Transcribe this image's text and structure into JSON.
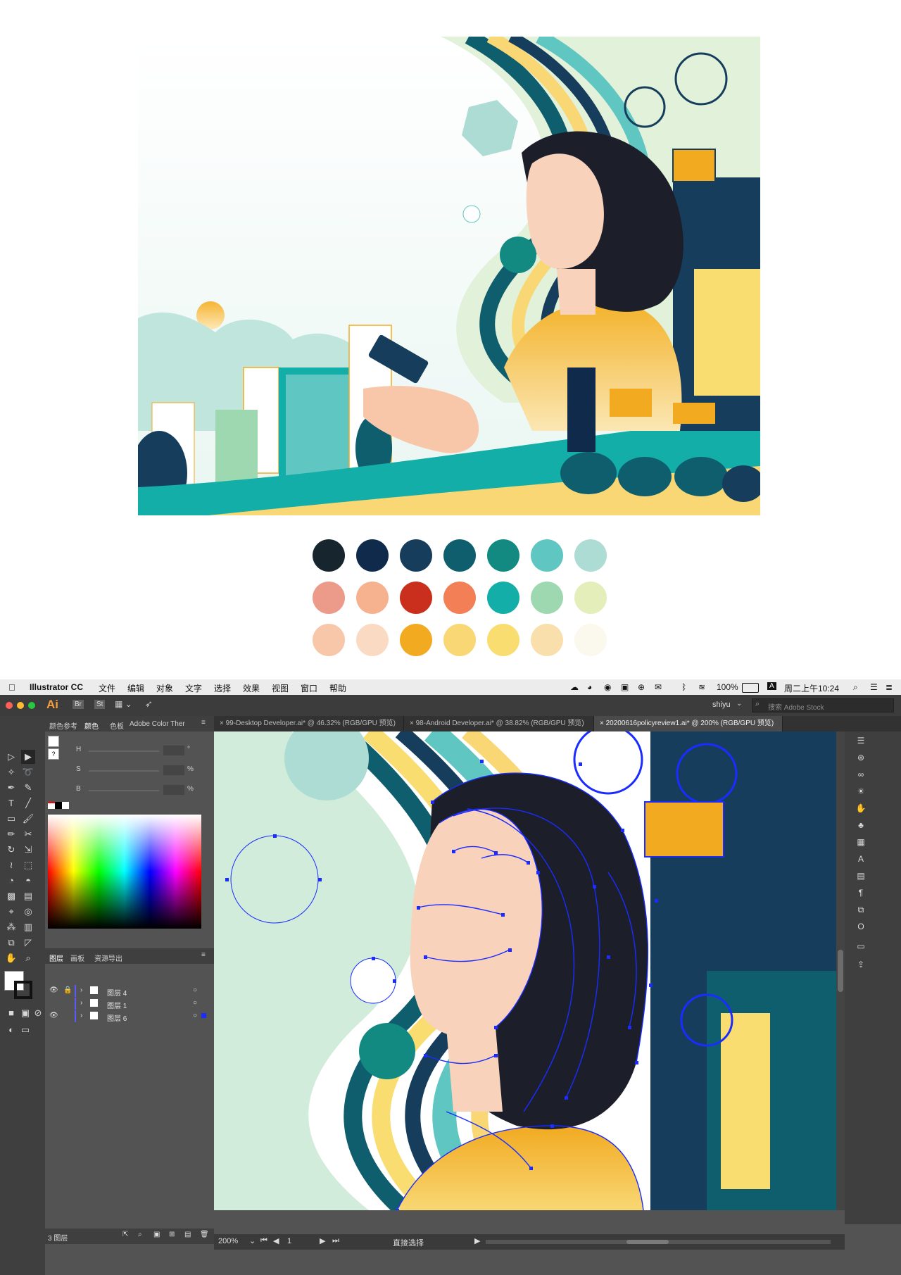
{
  "palette": {
    "row1": [
      "#16252e",
      "#0f2a4a",
      "#163e5c",
      "#0f5e6e",
      "#128a82",
      "#5fc6c2",
      "#acdcd3"
    ],
    "row2": [
      "#ec9a8a",
      "#f6b28e",
      "#c92f1c",
      "#f27f56",
      "#12aea7",
      "#9ed8b0",
      "#e3eebb"
    ],
    "row3": [
      "#f8c6a8",
      "#fbdac3",
      "#f2aa21",
      "#f8d774",
      "#f9dd70",
      "#f9dfab",
      "#fbf8ee"
    ]
  },
  "menubar": {
    "app_name": "Illustrator CC",
    "items": [
      "文件",
      "编辑",
      "对象",
      "文字",
      "选择",
      "效果",
      "视图",
      "窗口",
      "帮助"
    ],
    "battery": "100%",
    "input_method": "A",
    "clock": "周二上午10:24"
  },
  "control_bar": {
    "logo": "Ai",
    "br": "Br",
    "st": "St",
    "user": "shiyu",
    "search_placeholder": "搜索 Adobe Stock"
  },
  "tabs": [
    {
      "label": "99-Desktop Developer.ai* @ 46.32% (RGB/GPU 预览)",
      "active": false
    },
    {
      "label": "98-Android Developer.ai* @ 38.82% (RGB/GPU 预览)",
      "active": false
    },
    {
      "label": "20200616policyreview1.ai* @ 200% (RGB/GPU 预览)",
      "active": true
    }
  ],
  "color_panel": {
    "tabs": [
      "颜色参考",
      "颜色",
      "色板",
      "Adobe Color Ther"
    ],
    "h_label": "H",
    "s_label": "S",
    "b_label": "B",
    "degree": "°",
    "percent": "%"
  },
  "layers_panel": {
    "tabs": [
      "图层",
      "画板",
      "资源导出"
    ],
    "layers": [
      {
        "name": "图层 4",
        "color": "#5a5aff"
      },
      {
        "name": "图层 1",
        "color": "#5a5aff"
      },
      {
        "name": "图层 6",
        "color": "#5a5aff"
      }
    ],
    "count": "3 图层"
  },
  "status": {
    "zoom": "200%",
    "artboard": "1",
    "tool": "直接选择"
  },
  "colors": {
    "app_bg": "#535353",
    "anchor": "#1a2cff"
  }
}
